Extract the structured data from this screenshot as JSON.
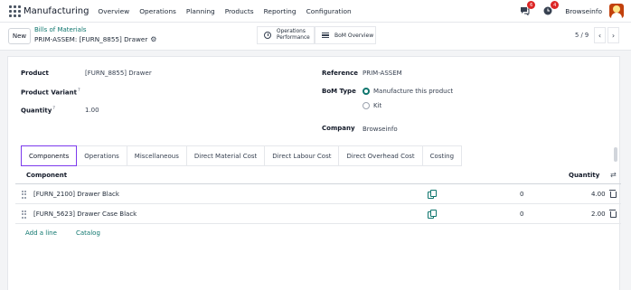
{
  "navbar": {
    "brand": "Manufacturing",
    "menu": [
      "Overview",
      "Operations",
      "Planning",
      "Products",
      "Reporting",
      "Configuration"
    ],
    "messages_count": "6",
    "activities_count": "4",
    "company": "Browseinfo"
  },
  "control": {
    "new_label": "New",
    "breadcrumb_parent": "Bills of Materials",
    "breadcrumb_current": "PRIM-ASSEM: [FURN_8855] Drawer",
    "ops_line1": "Operations",
    "ops_line2": "Performance",
    "bom_overview": "BoM Overview",
    "pager": "5 / 9"
  },
  "form": {
    "product_label": "Product",
    "product_value": "[FURN_8855] Drawer",
    "variant_label": "Product Variant",
    "quantity_label": "Quantity",
    "quantity_value": "1.00",
    "reference_label": "Reference",
    "reference_value": "PRIM-ASSEM",
    "bom_type_label": "BoM Type",
    "bom_type_options": [
      "Manufacture this product",
      "Kit"
    ],
    "bom_type_selected": "Manufacture this product",
    "company_label": "Company",
    "company_value": "Browseinfo",
    "help_mark": "?"
  },
  "tabs": [
    "Components",
    "Operations",
    "Miscellaneous",
    "Direct Material Cost",
    "Direct Labour Cost",
    "Direct Overhead Cost",
    "Costing"
  ],
  "active_tab": "Components",
  "table": {
    "col_component": "Component",
    "col_quantity": "Quantity",
    "rows": [
      {
        "component": "[FURN_2100] Drawer Black",
        "zero": "0",
        "quantity": "4.00"
      },
      {
        "component": "[FURN_5623] Drawer Case Black",
        "zero": "0",
        "quantity": "2.00"
      }
    ],
    "add_line": "Add a line",
    "catalog": "Catalog"
  },
  "colors": {
    "accent": "#0f766e",
    "active_tab_border": "#7c3aed",
    "badge": "#dc2626"
  }
}
